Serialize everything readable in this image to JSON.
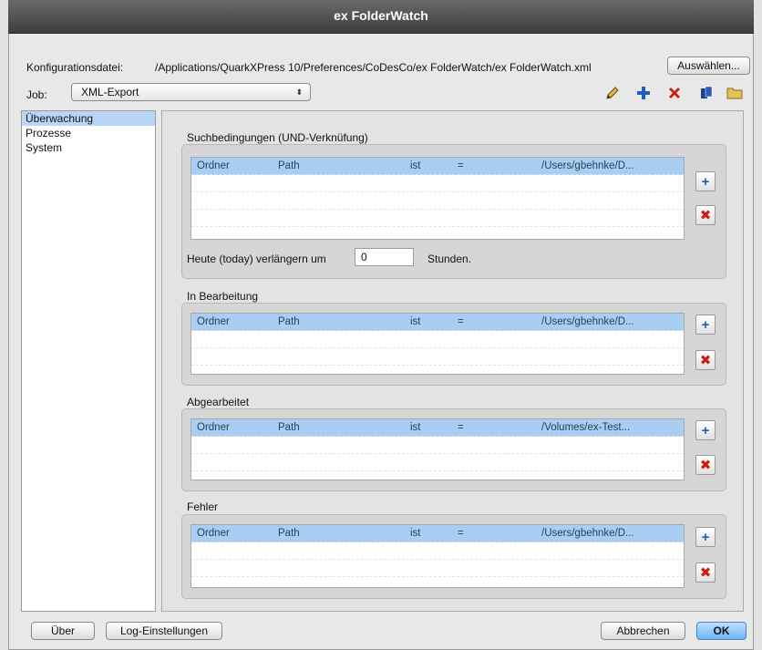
{
  "window": {
    "title": "ex FolderWatch"
  },
  "config": {
    "label": "Konfigurationsdatei:",
    "path": "/Applications/QuarkXPress 10/Preferences/CoDesCo/ex FolderWatch/ex FolderWatch.xml",
    "choose_button": "Auswählen..."
  },
  "job": {
    "label": "Job:",
    "selected": "XML-Export",
    "arrows": "⬍"
  },
  "toolbar": {
    "edit_icon": "pencil-icon",
    "add_icon": "plus-icon",
    "delete_icon": "x-icon",
    "duplicate_icon": "copy-icon",
    "folder_icon": "folder-icon"
  },
  "sidebar": {
    "items": [
      {
        "label": "Überwachung",
        "selected": true
      },
      {
        "label": "Prozesse",
        "selected": false
      },
      {
        "label": "System",
        "selected": false
      }
    ]
  },
  "groups": [
    {
      "title": "Suchbedingungen (UND-Verknüfung)",
      "row": {
        "c1": "Ordner",
        "c2": "Path",
        "c3": "ist",
        "c4": "=",
        "c5": "/Users/gbehnke/D..."
      }
    },
    {
      "title": "In Bearbeitung",
      "row": {
        "c1": "Ordner",
        "c2": "Path",
        "c3": "ist",
        "c4": "=",
        "c5": "/Users/gbehnke/D..."
      }
    },
    {
      "title": "Abgearbeitet",
      "row": {
        "c1": "Ordner",
        "c2": "Path",
        "c3": "ist",
        "c4": "=",
        "c5": "/Volumes/ex-Test..."
      }
    },
    {
      "title": "Fehler",
      "row": {
        "c1": "Ordner",
        "c2": "Path",
        "c3": "ist",
        "c4": "=",
        "c5": "/Users/gbehnke/D..."
      }
    }
  ],
  "extend": {
    "label": "Heute (today) verlängern um",
    "value": "0",
    "unit": "Stunden."
  },
  "buttons": {
    "about": "Über",
    "log": "Log-Einstellungen",
    "cancel": "Abbrechen",
    "ok": "OK"
  },
  "icons": {
    "plus": "+",
    "cross": "✖"
  },
  "colors": {
    "selection": "#aacdf3",
    "accent": "#1e5fb8",
    "danger": "#c9200e"
  }
}
